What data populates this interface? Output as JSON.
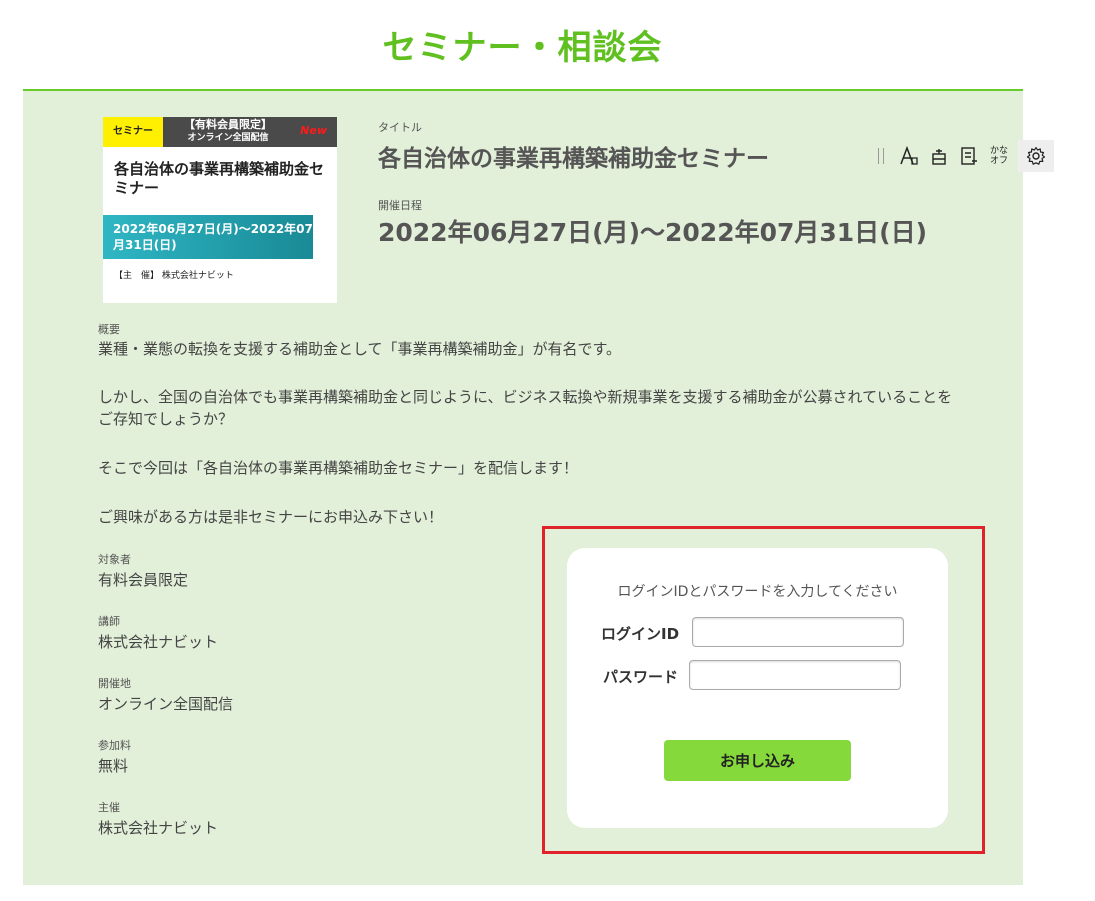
{
  "page": {
    "title": "セミナー・相談会"
  },
  "card": {
    "tag": "セミナー",
    "limited": "【有料会員限定】",
    "online": "オンライン全国配信",
    "new_badge": "New",
    "title": "各自治体の事業再構築補助金セミナー",
    "date": "2022年06月27日(月)〜2022年07月31日(日)",
    "host": "【主　催】 株式会社ナビット"
  },
  "detail": {
    "title_label": "タイトル",
    "title": "各自治体の事業再構築補助金セミナー",
    "date_label": "開催日程",
    "date": "2022年06月27日(月)〜2022年07月31日(日)",
    "summary_label": "概要",
    "summary_p1": "業種・業態の転換を支援する補助金として「事業再構築補助金」が有名です。",
    "summary_p2": "しかし、全国の自治体でも事業再構築補助金と同じように、ビジネス転換や新規事業を支援する補助金が公募されていることをご存知でしょうか？",
    "summary_p3": "そこで今回は「各自治体の事業再構築補助金セミナー」を配信します！",
    "summary_p4": "ご興味がある方は是非セミナーにお申込み下さい！",
    "target_label": "対象者",
    "target": "有料会員限定",
    "lecturer_label": "講師",
    "lecturer": "株式会社ナビット",
    "venue_label": "開催地",
    "venue": "オンライン全国配信",
    "fee_label": "参加料",
    "fee": "無料",
    "organizer_label": "主催",
    "organizer": "株式会社ナビット"
  },
  "toolbar": {
    "kana_line1": "かな",
    "kana_line2": "オフ"
  },
  "login": {
    "instruction": "ログインIDとパスワードを入力してください",
    "id_label": "ログインID",
    "id_value": "",
    "password_label": "パスワード",
    "password_value": "",
    "submit_label": "お申し込み"
  },
  "colors": {
    "brand_green": "#5fc020",
    "panel_bg": "#e2efd9",
    "button_green": "#86d93a",
    "highlight_red": "#e0222a"
  }
}
